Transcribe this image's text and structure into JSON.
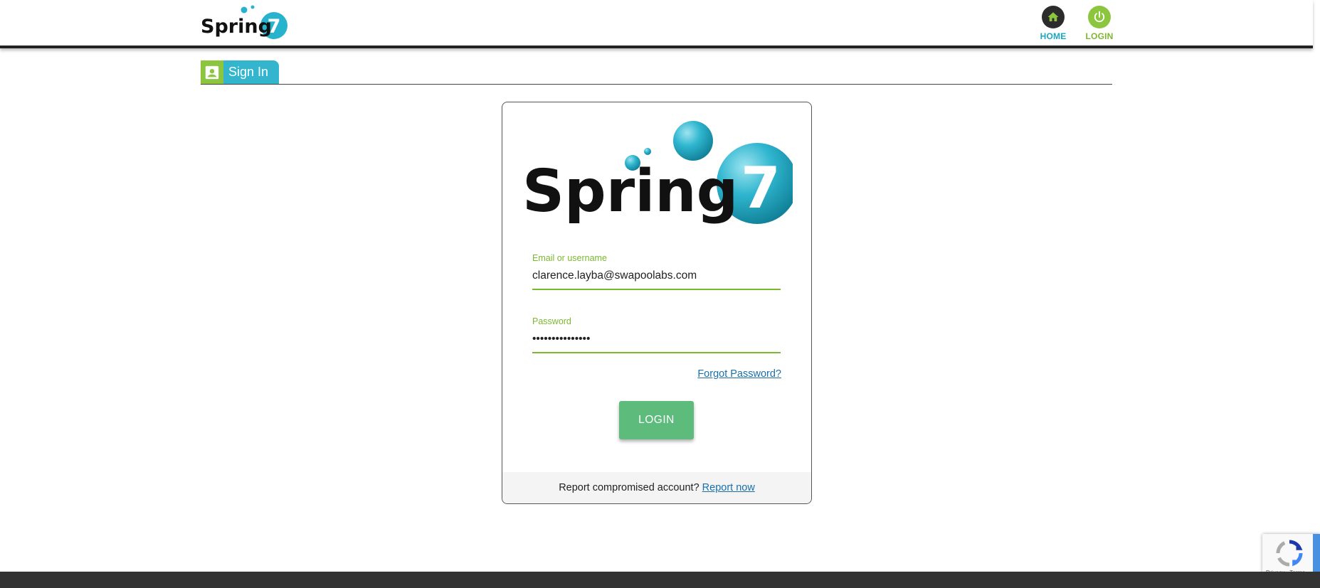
{
  "header": {
    "logo_text": "Spring",
    "logo_digit": "7",
    "nav": {
      "home_label": "HOME",
      "login_label": "LOGIN"
    }
  },
  "section_tab": {
    "label": "Sign In"
  },
  "login_card": {
    "logo_text": "Spring",
    "logo_digit": "7",
    "email_label": "Email or username",
    "email_value": "clarence.layba@swapoolabs.com",
    "password_label": "Password",
    "password_value": "passwordpasswor",
    "forgot_password_link": "Forgot Password?",
    "login_button": "LOGIN",
    "footer_text": "Report compromised account?",
    "footer_link": "Report now"
  },
  "recaptcha": {
    "footer_text": "Privacy - Terms"
  },
  "colors": {
    "brand_teal": "#33b5cd",
    "brand_green": "#8cc63f",
    "login_button": "#5dbb7c",
    "link_blue": "#1b6fa8",
    "dark_bar": "#333333"
  },
  "icons": {
    "home_nav": "home-icon",
    "login_nav": "power-icon",
    "sign_in_tab": "account-box-icon",
    "recaptcha": "recaptcha-icon"
  }
}
